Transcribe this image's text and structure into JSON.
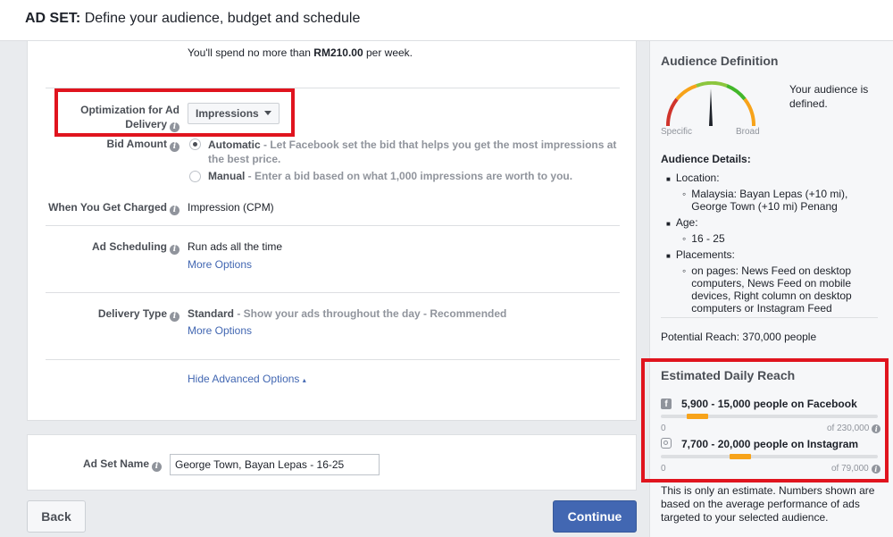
{
  "header": {
    "prefix": "AD SET:",
    "subtitle": "Define your audience, budget and schedule"
  },
  "budget": {
    "before": "You'll spend no more than ",
    "amount": "RM210.00",
    "after": " per week."
  },
  "optimization": {
    "label_line1": "Optimization for Ad",
    "label_line2": "Delivery",
    "value": "Impressions"
  },
  "bid_amount": {
    "label": "Bid Amount",
    "auto_title": "Automatic",
    "auto_desc_line1": " - Let Facebook set the bid that helps you get the most impressions at",
    "auto_desc_line2": "the best price.",
    "manual_title": "Manual",
    "manual_desc": " - Enter a bid based on what 1,000 impressions are worth to you."
  },
  "charged": {
    "label": "When You Get Charged",
    "value": "Impression (CPM)"
  },
  "scheduling": {
    "label": "Ad Scheduling",
    "value": "Run ads all the time",
    "link": "More Options"
  },
  "delivery_type": {
    "label": "Delivery Type",
    "value_bold": "Standard",
    "value_desc": " - Show your ads throughout the day - Recommended",
    "link": "More Options"
  },
  "advanced_link": "Hide Advanced Options",
  "ad_set_name": {
    "label": "Ad Set Name",
    "value": "George Town, Bayan Lepas - 16-25"
  },
  "buttons": {
    "back": "Back",
    "continue": "Continue"
  },
  "audience_definition": {
    "title": "Audience Definition",
    "status": "Your audience is defined.",
    "gauge_left": "Specific",
    "gauge_right": "Broad",
    "details_title": "Audience Details:",
    "location_label": "Location:",
    "location_value": "Malaysia: Bayan Lepas (+10 mi), George Town (+10 mi) Penang",
    "age_label": "Age:",
    "age_value": "16 - 25",
    "placements_label": "Placements:",
    "placements_value": "on pages: News Feed on desktop computers, News Feed on mobile devices, Right column on desktop computers or Instagram Feed",
    "potential_reach": "Potential Reach: 370,000 people"
  },
  "daily_reach": {
    "title": "Estimated Daily Reach",
    "facebook": {
      "text": "5,900 - 15,000 people on Facebook",
      "min": "0",
      "max": "of 230,000"
    },
    "instagram": {
      "text": "7,700 - 20,000 people on Instagram",
      "min": "0",
      "max": "of 79,000"
    },
    "note": "This is only an estimate. Numbers shown are based on the average performance of ads targeted to your selected audience."
  },
  "colors": {
    "accent": "#4267b2",
    "highlight": "#e0141e",
    "bar": "#f7a31a"
  }
}
